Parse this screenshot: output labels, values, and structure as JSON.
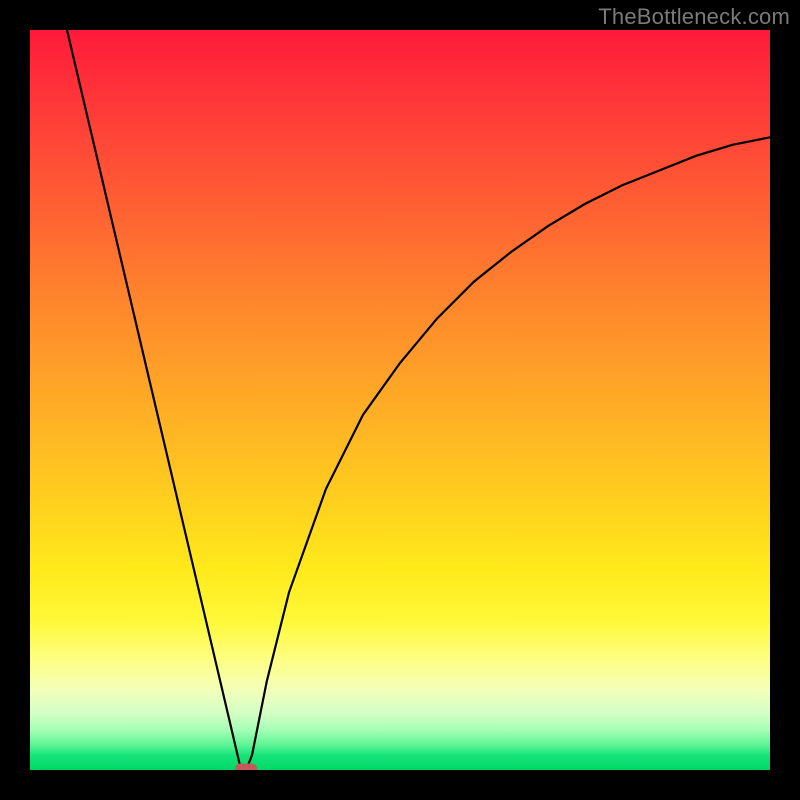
{
  "watermark": "TheBottleneck.com",
  "chart_data": {
    "type": "line",
    "title": "",
    "xlabel": "",
    "ylabel": "",
    "xlim": [
      0,
      100
    ],
    "ylim": [
      0,
      100
    ],
    "grid": false,
    "legend": false,
    "background": "rainbow-vertical-gradient",
    "frame_color": "#000000",
    "series": [
      {
        "name": "bottleneck-curve",
        "color": "#000000",
        "x": [
          5,
          7,
          9,
          11,
          13,
          15,
          17,
          19,
          21,
          23,
          25,
          27,
          28.4,
          29.2,
          30,
          32,
          35,
          40,
          45,
          50,
          55,
          60,
          65,
          70,
          75,
          80,
          85,
          90,
          95,
          100
        ],
        "values": [
          100,
          91.5,
          83,
          74.5,
          66,
          57.5,
          49,
          40.5,
          32,
          23.5,
          15,
          6.5,
          0.5,
          0,
          2,
          12,
          24,
          38,
          48,
          55,
          61,
          66,
          70,
          73.5,
          76.5,
          79,
          81,
          83,
          84.5,
          85.5
        ]
      }
    ],
    "marker": {
      "x": 29.2,
      "y": 0.2,
      "color": "#c35a5a",
      "shape": "rounded-rect"
    }
  }
}
